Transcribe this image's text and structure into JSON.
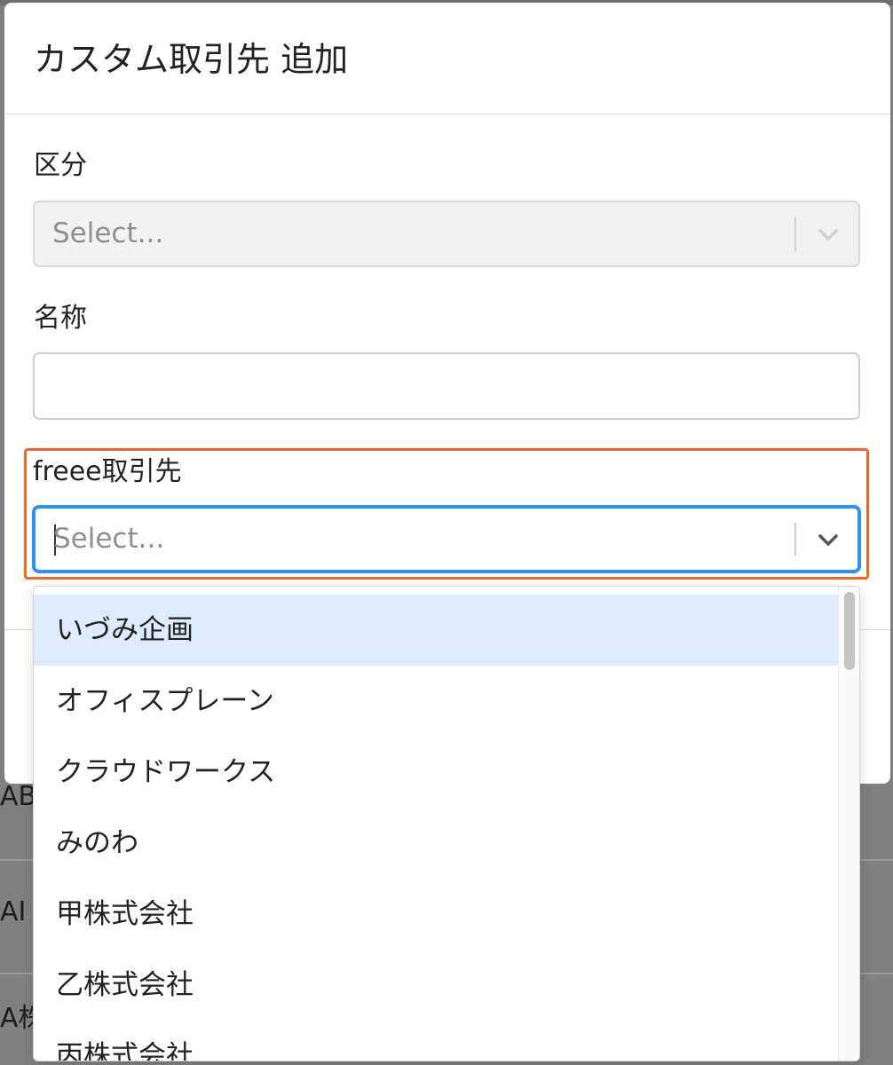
{
  "background": {
    "fragments": {
      "ab": "AB",
      "ai": "AI",
      "a_kabu": "A株"
    }
  },
  "modal": {
    "title": "カスタム取引先 追加",
    "fields": {
      "kubun": {
        "label": "区分",
        "placeholder": "Select...",
        "state": "disabled"
      },
      "meisho": {
        "label": "名称",
        "value": ""
      },
      "freee_partner": {
        "label": "freee取引先",
        "placeholder": "Select...",
        "state": "focused-open"
      }
    }
  },
  "dropdown": {
    "options": [
      "いづみ企画",
      "オフィスプレーン",
      "クラウドワークス",
      "みのわ",
      "甲株式会社",
      "乙株式会社",
      "丙株式会社"
    ],
    "highlighted_option": "いづみ企画"
  },
  "icons": {
    "chevron": "chevron-down-icon"
  },
  "colors": {
    "focus_border": "#2d8ff7",
    "highlight_outline": "#ef6a1b",
    "option_hover": "#dcebfd",
    "overlay": "#808080"
  }
}
